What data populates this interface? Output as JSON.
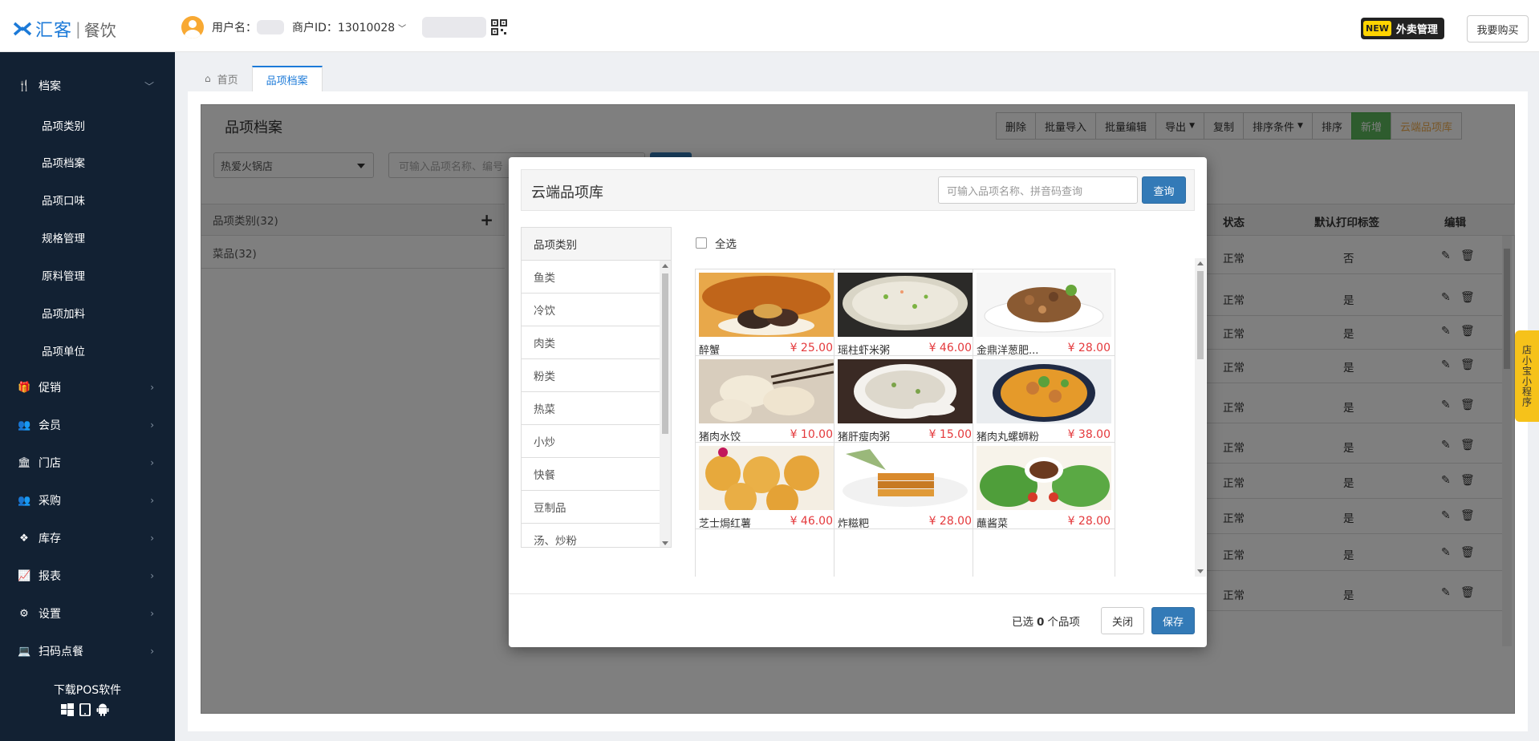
{
  "header": {
    "logo_text": "汇客",
    "logo_sep": "|",
    "logo_sub": "餐饮",
    "user_label": "用户名：",
    "merchant_label": "商户ID：13010028",
    "new_tag": "NEW",
    "takeout_label": "外卖管理",
    "buy_label": "我要购买"
  },
  "sidebar": {
    "archive_label": "档案",
    "subitems": [
      "品项类别",
      "品项档案",
      "品项口味",
      "规格管理",
      "原料管理",
      "品项加料",
      "品项单位"
    ],
    "items": [
      "促销",
      "会员",
      "门店",
      "采购",
      "库存",
      "报表",
      "设置",
      "扫码点餐"
    ],
    "download_label": "下载POS软件"
  },
  "tabs": [
    "首页",
    "品项档案"
  ],
  "page": {
    "title": "品项档案",
    "toolbar": [
      "删除",
      "批量导入",
      "批量编辑",
      "导出",
      "复制",
      "排序条件",
      "排序",
      "新增",
      "云端品项库"
    ],
    "store": "热爱火锅店",
    "search_placeholder": "可输入品项名称、编号",
    "cat_head": "品项类别(32)",
    "cat_row": "菜品(32)",
    "grid_head": [
      "状态",
      "默认打印标签",
      "编辑"
    ],
    "grid_rows": [
      {
        "status": "正常",
        "print": "否"
      },
      {
        "status": "正常",
        "print": "是"
      },
      {
        "status": "正常",
        "print": "是"
      },
      {
        "status": "正常",
        "print": "是"
      },
      {
        "status": "正常",
        "print": "是"
      },
      {
        "status": "正常",
        "print": "是"
      },
      {
        "status": "正常",
        "print": "是"
      },
      {
        "status": "正常",
        "print": "是"
      },
      {
        "status": "正常",
        "print": "是"
      },
      {
        "status": "正常",
        "print": "是"
      }
    ]
  },
  "modal": {
    "title": "云端品项库",
    "search_placeholder": "可输入品项名称、拼音码查询",
    "search_btn": "查询",
    "cat_head": "品项类别",
    "categories": [
      "鱼类",
      "冷饮",
      "肉类",
      "粉类",
      "热菜",
      "小炒",
      "快餐",
      "豆制品",
      "汤、炒粉"
    ],
    "select_all": "全选",
    "items": [
      {
        "name": "醉蟹",
        "price": "¥ 25.00"
      },
      {
        "name": "瑶柱虾米粥",
        "price": "¥ 46.00"
      },
      {
        "name": "金鼎洋葱肥...",
        "price": "¥ 28.00"
      },
      {
        "name": "猪肉水饺",
        "price": "¥ 10.00"
      },
      {
        "name": "猪肝瘦肉粥",
        "price": "¥ 15.00"
      },
      {
        "name": "猪肉丸螺蛳粉",
        "price": "¥ 38.00"
      },
      {
        "name": "芝士焗红薯",
        "price": "¥ 46.00"
      },
      {
        "name": "炸糍粑",
        "price": "¥ 28.00"
      },
      {
        "name": "蘸酱菜",
        "price": "¥ 28.00"
      }
    ],
    "count_prefix": "已选",
    "count_value": "0",
    "count_suffix": "个品项",
    "close_btn": "关闭",
    "save_btn": "保存"
  },
  "mini_program": "店小宝小程序",
  "colors": {
    "brand": "#1c7ad8",
    "sidebar": "#122133",
    "primary": "#337ab7",
    "green": "#5cb85c",
    "price": "#e4393c"
  }
}
